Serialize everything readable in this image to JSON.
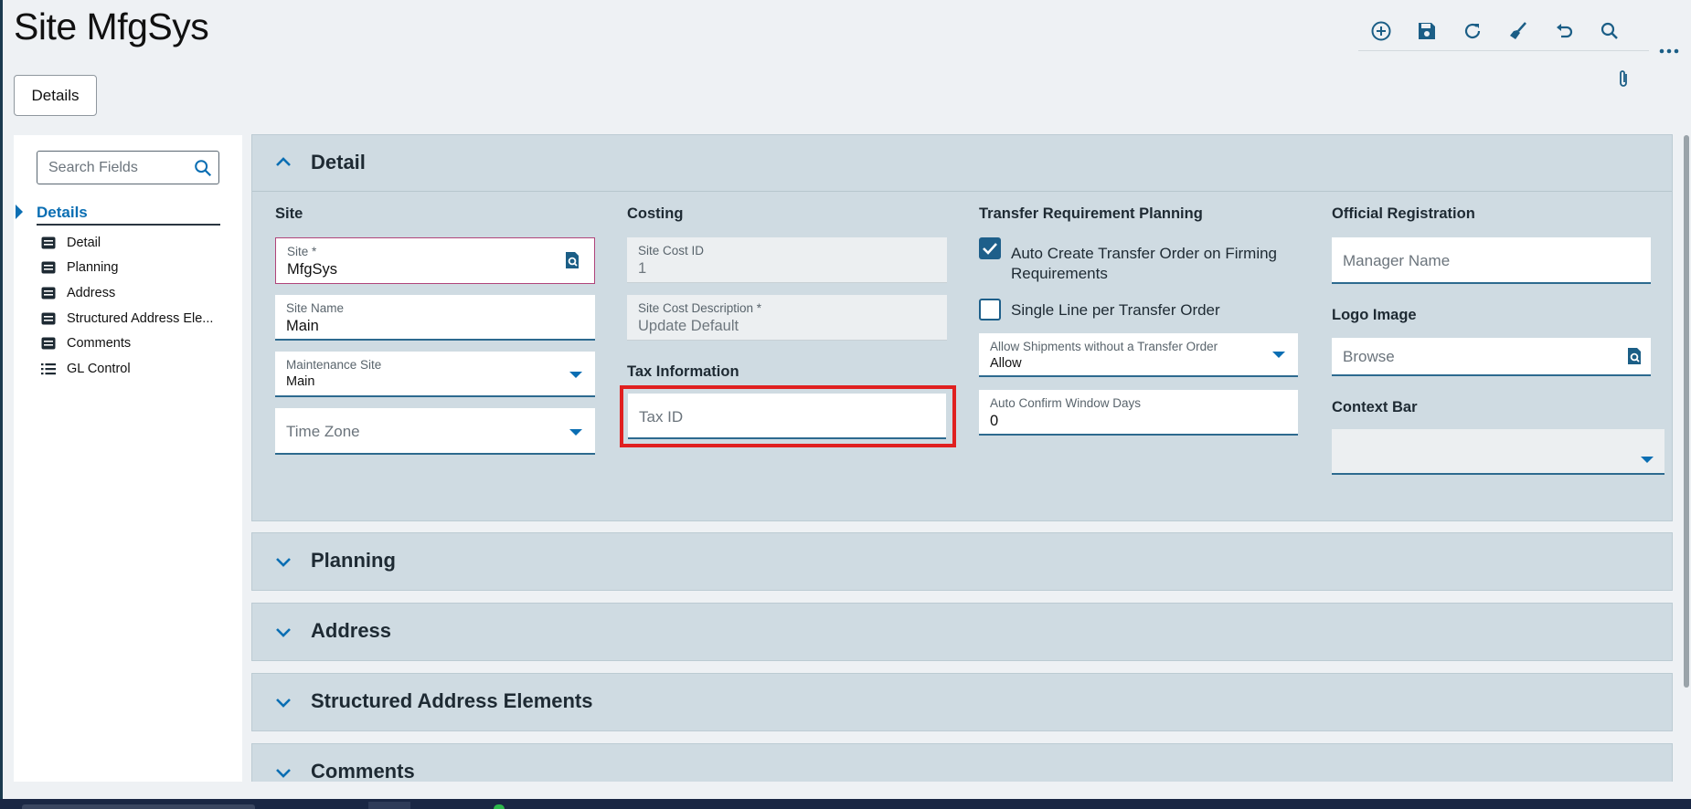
{
  "page": {
    "title": "Site MfgSys"
  },
  "toolbar": {
    "buttons": [
      "add-icon",
      "save-icon",
      "refresh-icon",
      "clear-icon",
      "undo-icon",
      "search-icon"
    ],
    "more": "more-icon",
    "attach": "paperclip-icon"
  },
  "tabs": {
    "details": "Details"
  },
  "sidebar": {
    "search_placeholder": "Search Fields",
    "group": "Details",
    "items": [
      {
        "label": "Detail",
        "icon": "form-icon"
      },
      {
        "label": "Planning",
        "icon": "form-icon"
      },
      {
        "label": "Address",
        "icon": "form-icon"
      },
      {
        "label": "Structured Address Ele...",
        "icon": "form-icon"
      },
      {
        "label": "Comments",
        "icon": "form-icon"
      },
      {
        "label": "GL Control",
        "icon": "list-icon"
      }
    ]
  },
  "sections": {
    "detail": "Detail",
    "planning": "Planning",
    "address": "Address",
    "structured": "Structured Address Elements",
    "comments": "Comments"
  },
  "site": {
    "heading": "Site",
    "site_label": "Site *",
    "site_value": "MfgSys",
    "name_label": "Site Name",
    "name_value": "Main",
    "maint_label": "Maintenance Site",
    "maint_value": "Main",
    "tz_placeholder": "Time Zone"
  },
  "costing": {
    "heading": "Costing",
    "cost_id_label": "Site Cost ID",
    "cost_id_value": "1",
    "cost_desc_label": "Site Cost Description *",
    "cost_desc_value": "Update Default"
  },
  "tax": {
    "heading": "Tax Information",
    "tax_id_placeholder": "Tax ID"
  },
  "transfer": {
    "heading": "Transfer Requirement Planning",
    "auto_create_line1": "Auto Create Transfer Order on Firming",
    "auto_create_line2": "Requirements",
    "auto_create_checked": true,
    "single_line": "Single Line per Transfer Order",
    "single_line_checked": false,
    "allow_ship_label": "Allow Shipments without a Transfer Order",
    "allow_ship_value": "Allow",
    "auto_confirm_label": "Auto Confirm Window Days",
    "auto_confirm_value": "0"
  },
  "official": {
    "heading": "Official Registration",
    "manager_placeholder": "Manager Name",
    "logo_heading": "Logo Image",
    "browse_placeholder": "Browse",
    "context_heading": "Context Bar",
    "context_value": ""
  },
  "colors": {
    "accent": "#0a6eb3",
    "section_bg": "#cfdbe2",
    "highlight": "#e02020",
    "required_border": "#b0447a"
  }
}
